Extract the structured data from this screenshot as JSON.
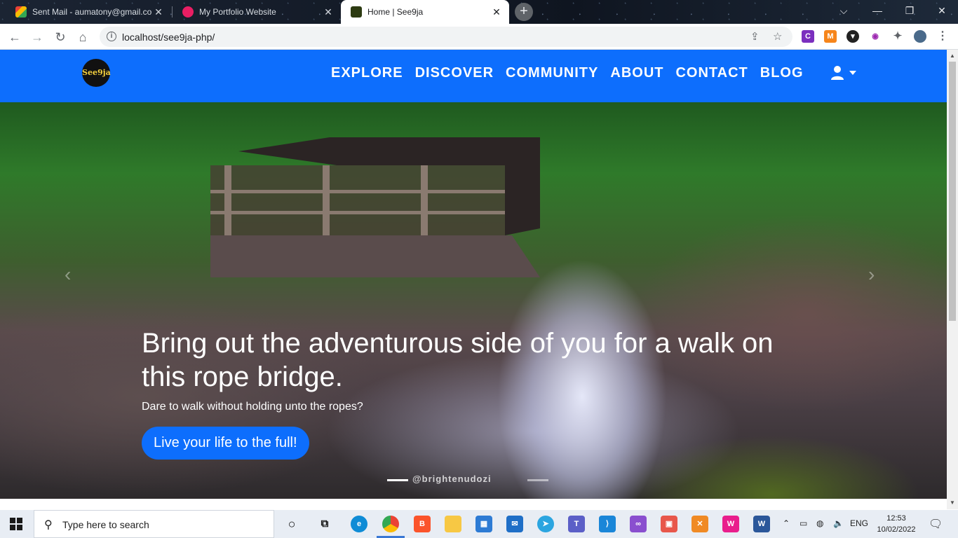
{
  "browser": {
    "tabs": [
      {
        "label": "Sent Mail - aumatony@gmail.co",
        "favicon_color": "#d93025",
        "active": false
      },
      {
        "label": "My Portfolio Website",
        "favicon_color": "#e91e63",
        "active": false
      },
      {
        "label": "Home | See9ja",
        "favicon_color": "#2d3b12",
        "active": true
      }
    ],
    "new_tab": "+",
    "url": "localhost/see9ja-php/",
    "controls": {
      "minimize": "—",
      "restore": "❐",
      "close": "✕",
      "tab_search": "⌵"
    }
  },
  "site": {
    "logo_text": "See9ja",
    "nav": [
      "EXPLORE",
      "DISCOVER",
      "COMMUNITY",
      "ABOUT",
      "CONTACT",
      "BLOG"
    ],
    "brand_color": "#0d6efd",
    "hero": {
      "title": "Bring out the adventurous side of you for a walk on this rope bridge.",
      "subtitle": "Dare to walk without holding unto the ropes?",
      "cta": "Live your life to the full!",
      "watermark": "@brightenudozi",
      "slides": 3,
      "active_slide": 0
    }
  },
  "taskbar": {
    "search_placeholder": "Type here to search",
    "language": "ENG",
    "time": "12:53",
    "date": "10/02/2022"
  }
}
